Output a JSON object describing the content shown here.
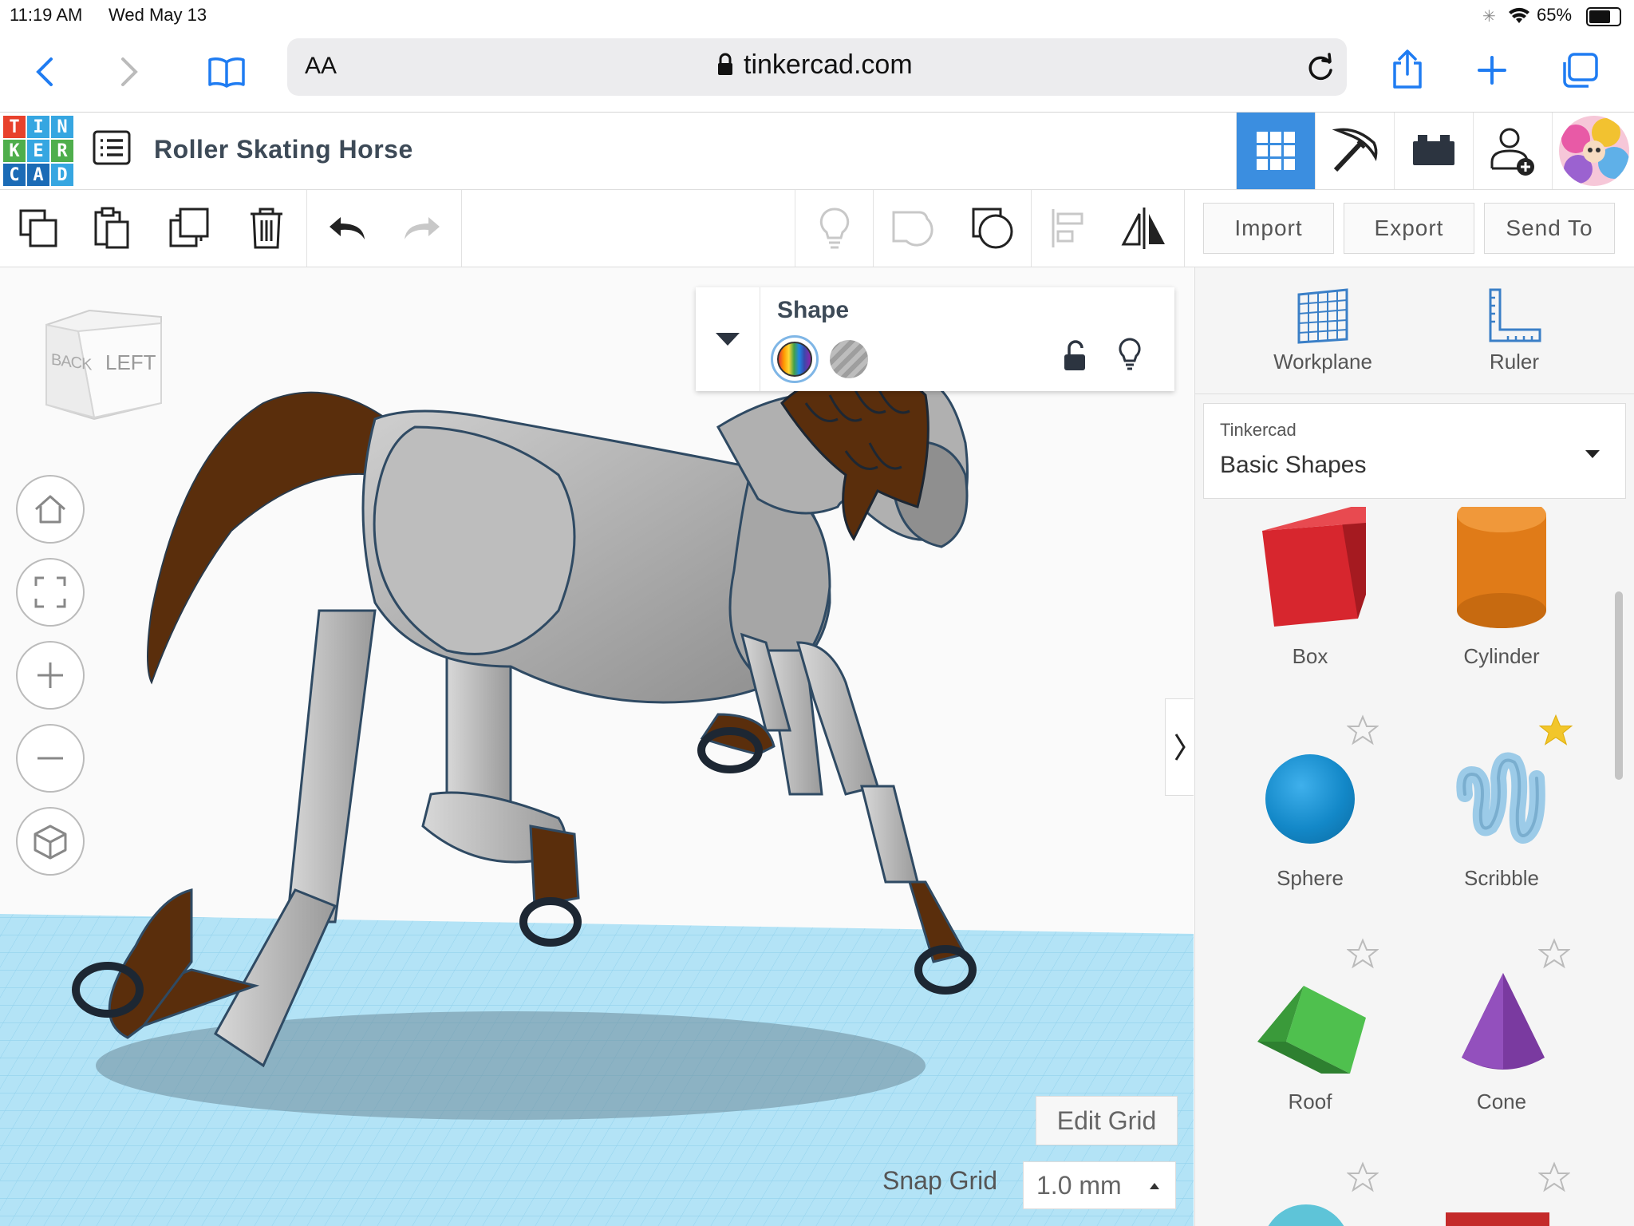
{
  "status_bar": {
    "time": "11:19 AM",
    "date": "Wed May 13",
    "battery": "65%"
  },
  "safari": {
    "text_size_label": "AA",
    "url": "tinkercad.com"
  },
  "header": {
    "logo_letters": [
      "T",
      "I",
      "N",
      "K",
      "E",
      "R",
      "C",
      "A",
      "D"
    ],
    "logo_colors": [
      "#e8412c",
      "#36a6e1",
      "#36a6e1",
      "#4fae4c",
      "#36a6e1",
      "#4fae4c",
      "#1b6bb6",
      "#1b6bb6",
      "#36a6e1"
    ],
    "design_title": "Roller Skating Horse",
    "active_color": "#3b8ee0"
  },
  "toolbar": {
    "import_label": "Import",
    "export_label": "Export",
    "send_to_label": "Send To"
  },
  "viewcube": {
    "back_label": "BACK",
    "left_label": "LEFT"
  },
  "inspector": {
    "title": "Shape"
  },
  "sidepanel": {
    "workplane_label": "Workplane",
    "ruler_label": "Ruler",
    "library_group": "Tinkercad",
    "library_name": "Basic Shapes",
    "shapes": [
      {
        "name": "Box",
        "color": "#d7262e",
        "favorite": false
      },
      {
        "name": "Cylinder",
        "color": "#e07b18",
        "favorite": true
      },
      {
        "name": "Sphere",
        "color": "#1990d0",
        "favorite": false
      },
      {
        "name": "Scribble",
        "color": "#9ccbe8",
        "favorite": true
      },
      {
        "name": "Roof",
        "color": "#3ea740",
        "favorite": false
      },
      {
        "name": "Cone",
        "color": "#7a3aa0",
        "favorite": false
      }
    ]
  },
  "grid": {
    "edit_grid_label": "Edit Grid",
    "snap_grid_label": "Snap Grid",
    "snap_grid_value": "1.0 mm"
  }
}
